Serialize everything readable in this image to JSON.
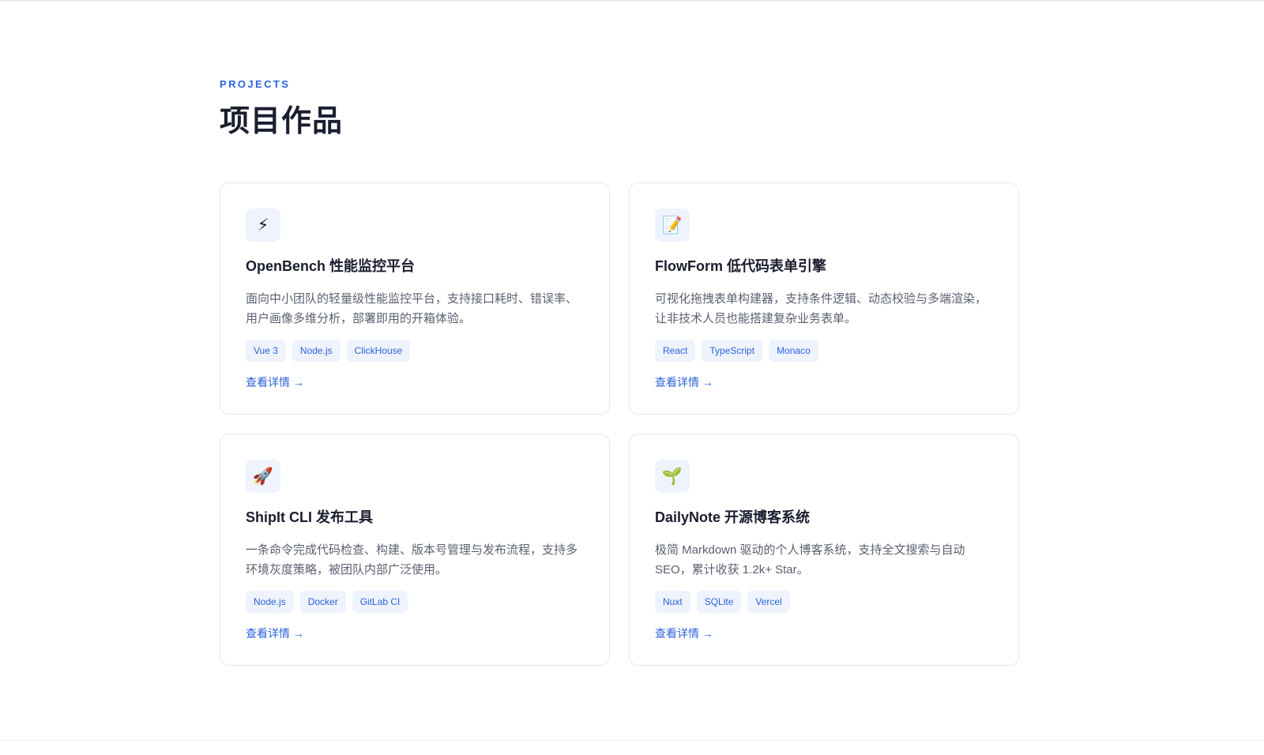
{
  "section": {
    "eyebrow": "PROJECTS",
    "title": "项目作品"
  },
  "projects": [
    {
      "icon": "⚡",
      "icon_name": "lightning-icon",
      "title": "OpenBench 性能监控平台",
      "description": "面向中小团队的轻量级性能监控平台，支持接口耗时、错误率、用户画像多维分析，部署即用的开箱体验。",
      "tags": [
        "Vue 3",
        "Node.js",
        "ClickHouse"
      ],
      "link_label": "查看详情 →"
    },
    {
      "icon": "📝",
      "icon_name": "memo-icon",
      "title": "FlowForm 低代码表单引擎",
      "description": "可视化拖拽表单构建器，支持条件逻辑、动态校验与多端渲染，让非技术人员也能搭建复杂业务表单。",
      "tags": [
        "React",
        "TypeScript",
        "Monaco"
      ],
      "link_label": "查看详情 →"
    },
    {
      "icon": "🚀",
      "icon_name": "rocket-icon",
      "title": "ShipIt CLI 发布工具",
      "description": "一条命令完成代码检查、构建、版本号管理与发布流程，支持多环境灰度策略，被团队内部广泛使用。",
      "tags": [
        "Node.js",
        "Docker",
        "GitLab CI"
      ],
      "link_label": "查看详情 →"
    },
    {
      "icon": "🌱",
      "icon_name": "seedling-icon",
      "title": "DailyNote 开源博客系统",
      "description": "极简 Markdown 驱动的个人博客系统，支持全文搜索与自动 SEO，累计收获 1.2k+ Star。",
      "tags": [
        "Nuxt",
        "SQLite",
        "Vercel"
      ],
      "link_label": "查看详情 →"
    }
  ],
  "colors": {
    "accent": "#2b63d9",
    "tag_bg": "#eef3fd",
    "border": "#e6e8ec",
    "heading": "#1a1d2e",
    "body_text": "#5a6070"
  }
}
